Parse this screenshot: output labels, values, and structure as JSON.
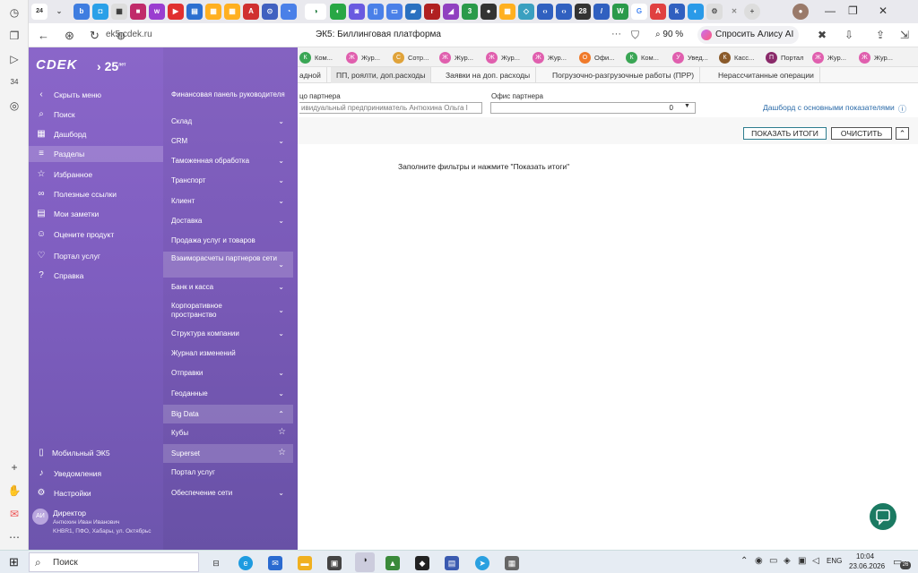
{
  "browser": {
    "url": "ek5.cdek.ru",
    "page_title": "ЭК5: Биллинговая платформа",
    "zoom": "90 %",
    "alice_label": "Спросить Алису AI",
    "tab_count_badge": "24",
    "menu_dots": "···"
  },
  "app": {
    "logo": "CDEK",
    "logo_anniv": "25",
    "logo_anniv_sup": "лет"
  },
  "sidebar": {
    "items": [
      {
        "label": "Скрыть меню",
        "icon": "chevron-left-icon"
      },
      {
        "label": "Поиск",
        "icon": "search-icon"
      },
      {
        "label": "Дашборд",
        "icon": "dashboard-icon"
      },
      {
        "label": "Разделы",
        "icon": "menu-icon"
      },
      {
        "label": "Избранное",
        "icon": "star-icon"
      },
      {
        "label": "Полезные ссылки",
        "icon": "link-icon"
      },
      {
        "label": "Мои заметки",
        "icon": "notes-icon"
      },
      {
        "label": "Оцените продукт",
        "icon": "rate-icon"
      },
      {
        "label": "Портал услуг",
        "icon": "portal-icon"
      },
      {
        "label": "Справка",
        "icon": "help-icon"
      }
    ],
    "bottom": {
      "mobile": "Мобильный ЭК5",
      "notifications": "Уведомления",
      "settings": "Настройки"
    },
    "user": {
      "initials": "АИ",
      "role": "Директор",
      "name": "Антюхин Иван Иванович",
      "office": "KHBR1, ПФО, Хабары, ул. Октябрьс"
    }
  },
  "sections": [
    {
      "label": "Финансовая панель руководителя"
    },
    {
      "label": "Склад"
    },
    {
      "label": "CRM"
    },
    {
      "label": "Таможенная обработка"
    },
    {
      "label": "Транспорт"
    },
    {
      "label": "Клиент"
    },
    {
      "label": "Доставка"
    },
    {
      "label": "Продажа услуг и товаров"
    },
    {
      "label": "Взаиморасчеты партнеров сети"
    },
    {
      "label": "Банк и касса"
    },
    {
      "label": "Корпоративное пространство"
    },
    {
      "label": "Структура компании"
    },
    {
      "label": "Журнал изменений"
    },
    {
      "label": "Отправки"
    },
    {
      "label": "Геоданные"
    },
    {
      "label": "Big Data"
    },
    {
      "label": "Кубы"
    },
    {
      "label": "Superset"
    },
    {
      "label": "Портал услуг"
    },
    {
      "label": "Обеспечение сети"
    }
  ],
  "group_tabs": [
    {
      "letter": "К",
      "label": "Ком...",
      "color": "#3aa655"
    },
    {
      "letter": "Ж",
      "label": "Жур...",
      "color": "#e05fae"
    },
    {
      "letter": "С",
      "label": "Сотр...",
      "color": "#e0a33a"
    },
    {
      "letter": "Ж",
      "label": "Жур...",
      "color": "#e05fae"
    },
    {
      "letter": "Ж",
      "label": "Жур...",
      "color": "#e05fae"
    },
    {
      "letter": "Ж",
      "label": "Жур...",
      "color": "#e05fae"
    },
    {
      "letter": "О",
      "label": "Офи...",
      "color": "#f07a2a"
    },
    {
      "letter": "К",
      "label": "Ком...",
      "color": "#3aa655"
    },
    {
      "letter": "У",
      "label": "Увед...",
      "color": "#e05fae"
    },
    {
      "letter": "К",
      "label": "Касс...",
      "color": "#8a5a2a"
    },
    {
      "letter": "П",
      "label": "Портал",
      "color": "#8a2a6a"
    },
    {
      "letter": "Ж",
      "label": "Жур...",
      "color": "#e05fae"
    },
    {
      "letter": "Ж",
      "label": "Жур...",
      "color": "#e05fae"
    }
  ],
  "sub_tabs": [
    {
      "label": "адной"
    },
    {
      "label": "ПП, роялти, доп.расходы"
    },
    {
      "label": "Заявки на доп. расходы"
    },
    {
      "label": "Погрузочно-разгрузочные работы (ПРР)"
    },
    {
      "label": "Нерассчитанные операции"
    }
  ],
  "filters": {
    "partner_label": "цо партнера",
    "partner_value": "ивидуальный предприниматель Антюхина Ольга I",
    "office_label": "Офис партнера",
    "office_value": "0",
    "dashboard_link": "Дашборд с основными показателями"
  },
  "buttons": {
    "show": "ПОКАЗАТЬ ИТОГИ",
    "clear": "ОЧИСТИТЬ"
  },
  "main": {
    "hint": "Заполните фильтры и нажмите \"Показать итоги\""
  },
  "taskbar": {
    "search": "Поиск",
    "lang": "ENG",
    "time": "10:04",
    "date": "23.06.2026",
    "notif_count": "26"
  }
}
